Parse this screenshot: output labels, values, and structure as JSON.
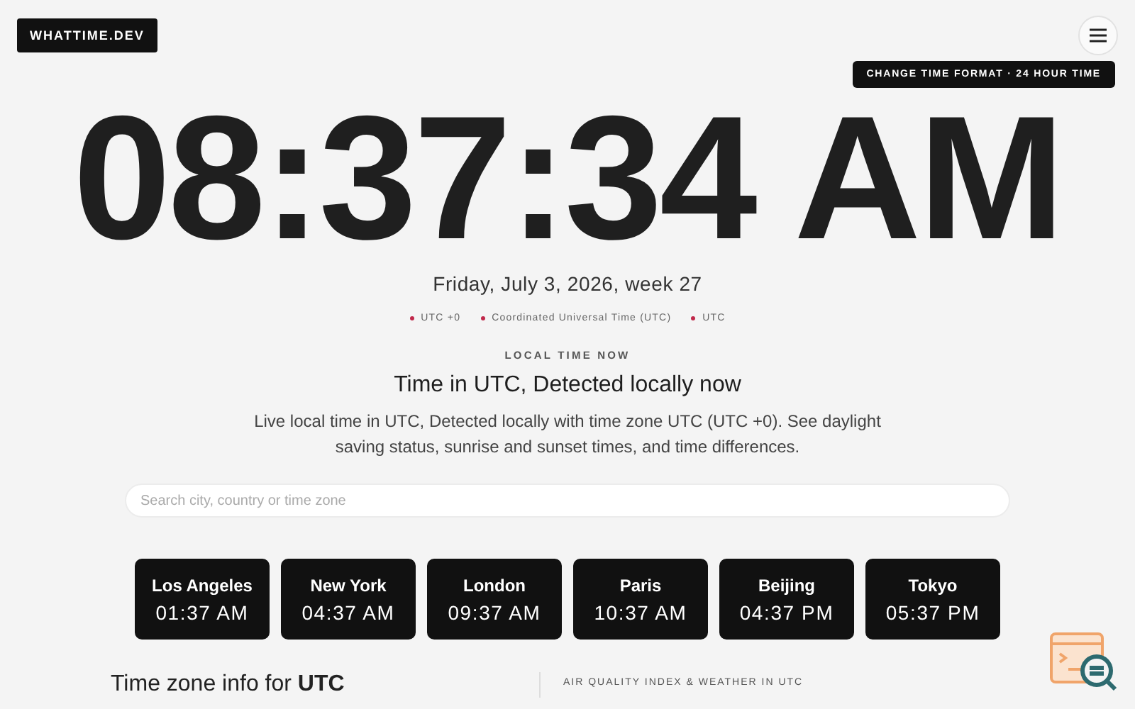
{
  "logo": "WHATTIME.DEV",
  "format_button": "CHANGE TIME FORMAT · 24 HOUR TIME",
  "clock": "08:37:34 AM",
  "date": "Friday, July 3, 2026, week 27",
  "meta": [
    {
      "text": "UTC +0",
      "color": "#c0284a"
    },
    {
      "text": "Coordinated Universal Time (UTC)",
      "color": "#c0284a"
    },
    {
      "text": "UTC",
      "color": "#c0284a"
    }
  ],
  "eyebrow": "LOCAL TIME NOW",
  "heading": "Time in UTC, Detected locally now",
  "description": "Live local time in UTC, Detected locally with time zone UTC (UTC +0). See daylight saving status, sunrise and sunset times, and time differences.",
  "search": {
    "placeholder": "Search city, country or time zone"
  },
  "cities": [
    {
      "name": "Los Angeles",
      "time": "01:37 AM"
    },
    {
      "name": "New York",
      "time": "04:37 AM"
    },
    {
      "name": "London",
      "time": "09:37 AM"
    },
    {
      "name": "Paris",
      "time": "10:37 AM"
    },
    {
      "name": "Beijing",
      "time": "04:37 PM"
    },
    {
      "name": "Tokyo",
      "time": "05:37 PM"
    }
  ],
  "bottom": {
    "left": "Time zone info for **UTC**",
    "right": "AIR QUALITY INDEX & WEATHER IN UTC"
  }
}
